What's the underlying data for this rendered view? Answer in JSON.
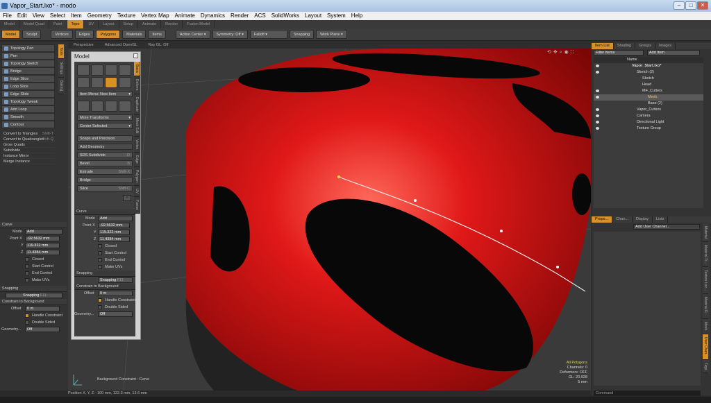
{
  "window": {
    "title": "Vapor_Start.lxo* - modo"
  },
  "menu": [
    "File",
    "Edit",
    "View",
    "Select",
    "Item",
    "Geometry",
    "Texture",
    "Vertex Map",
    "Animate",
    "Dynamics",
    "Render",
    "ACS",
    "SolidWorks",
    "Layout",
    "System",
    "Help"
  ],
  "layout_tabs": [
    "Model",
    "Model Quad",
    "Paint",
    "Topo",
    "UV",
    "Layout",
    "Setup",
    "Animate",
    "Render",
    "Fusion Model"
  ],
  "layout_active": "Topo",
  "toolbar": {
    "model": "Model",
    "sculpt": "Sculpt",
    "vertices": "Vertices",
    "edges": "Edges",
    "polygons": "Polygons",
    "materials": "Materials",
    "items": "Items",
    "action_center": "Action Center",
    "symmetry": "Symmetry: Off",
    "falloff": "Falloff",
    "snapping": "Snapping",
    "work_plane": "Work Plane"
  },
  "left_tools": [
    "Topology Pen",
    "Pen",
    "Topology Sketch",
    "Bridge",
    "Edge Slice",
    "Loop Slice",
    "Edge Slide",
    "Topology Tweak",
    "Add Loop",
    "Smooth",
    "Contour"
  ],
  "left_cmds": [
    "Convert to Triangles",
    "Convert to Quadrangles",
    "Grow Quads",
    "Subdivide",
    "Instance Mirror",
    "Merge Instance"
  ],
  "left_cmd_shortcuts": {
    "triangles": "Shift-T",
    "quadrangles": "Shift-Q"
  },
  "left_vtabs": [
    "Tools",
    "Settings",
    "Baking"
  ],
  "curve_panel": {
    "title": "Curve",
    "mode_label": "Mode",
    "mode_value": "Add",
    "point_label": "Point X",
    "x": "-92.5632 mm",
    "y_label": "Y",
    "y": "119.322 mm",
    "z_label": "Z",
    "z": "11.4384 mm",
    "closed": "Closed",
    "start_control": "Start Control",
    "end_control": "End Control",
    "make_uvs": "Make UVs",
    "snapping_title": "Snapping",
    "snapping_btn": "Snapping",
    "snapping_key": "F11",
    "constrain_title": "Constrain to Background",
    "offset_label": "Offset",
    "offset_value": "0 m",
    "handle_constraint": "Handle Constraint",
    "double_sided": "Double Sided",
    "geometry_label": "Geometry...",
    "geometry_value": "Off"
  },
  "viewport": {
    "tabs": [
      "Perspective",
      "Advanced OpenGL",
      "Ray GL: Off"
    ],
    "bg_constraint": "Background Constraint : Curve",
    "info": [
      "All Polygons",
      "Channels: 0",
      "Deformers: OFF",
      "GL: 20,928",
      "5 mm"
    ],
    "status": "Position X, Y, Z:  -100 mm, 122.3 mm, 13.6 mm"
  },
  "model_palette": {
    "title": "Model",
    "item_menu": "Item Menu: New Item",
    "more_transforms": "More Transforms",
    "center_selected": "Center Selected",
    "snaps": "Snaps and Precision",
    "add_geometry": "Add Geometry",
    "sds_subdivide": "SDS Subdivide",
    "sds_key": "D",
    "bevel": "Bevel",
    "bevel_key": "B",
    "extrude": "Extrude",
    "extrude_key": "Shift-X",
    "bridge": "Bridge",
    "slice": "Slice",
    "slice_key": "Shift-C",
    "vtabs": [
      "Basic",
      "Deform",
      "Duplicate",
      "Mesh Edit",
      "Vertex",
      "Edge",
      "Polygon",
      "UV",
      "Fusion"
    ]
  },
  "palette_curve": {
    "title": "Curve",
    "mode_label": "Mode",
    "mode_value": "Add",
    "point_label": "Point X",
    "x": "-92.5632 mm",
    "y_label": "Y",
    "y": "119.322 mm",
    "z_label": "Z",
    "z": "11.4384 mm",
    "closed": "Closed",
    "start_control": "Start Control",
    "end_control": "End Control",
    "make_uvs": "Make UVs",
    "snapping_title": "Snapping",
    "snapping_btn": "Snapping",
    "snapping_key": "F11",
    "constrain_title": "Constrain to Background",
    "offset_label": "Offset",
    "offset_value": "0 m",
    "handle_constraint": "Handle Constraint",
    "double_sided": "Double Sided",
    "geometry_label": "Geometry...",
    "geometry_value": "Off"
  },
  "item_list": {
    "tabs": [
      "Item List",
      "Shading",
      "Groups",
      "Images"
    ],
    "filter": "Filter Items",
    "add_item": "Add Item",
    "name_header": "Name",
    "rows": [
      "Vapor_Start.lxo*",
      "Sketch (2)",
      "Sketch",
      "Head",
      "MF_Cutters",
      "Mesh",
      "Base (2)",
      "Vapor_Cutters",
      "Camera",
      "Directional Light",
      "Texture Group"
    ]
  },
  "properties": {
    "tabs": [
      "Prope...",
      "Chan...",
      "Display",
      "Lists"
    ],
    "add_user_channel": "Add User Channel...",
    "vtabs": [
      "Material",
      "Material Tr...",
      "Texture Loc...",
      "Material R...",
      "Mesh",
      "User Chan...",
      "Tags"
    ],
    "command": "Command"
  },
  "colors": {
    "accent": "#d8912a",
    "helmet": "#cc1010"
  }
}
